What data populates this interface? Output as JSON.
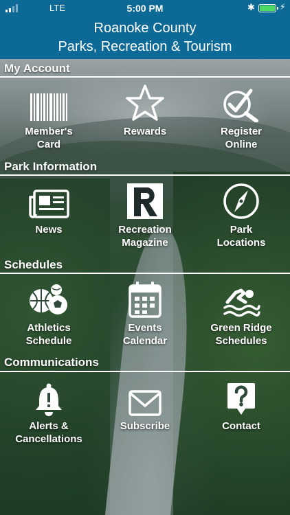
{
  "status_bar": {
    "carrier": "LTE",
    "time": "5:00 PM",
    "battery_level": 1.0
  },
  "header": {
    "title_line1": "Roanoke County",
    "title_line2": "Parks, Recreation & Tourism",
    "background_color": "#0d6a96"
  },
  "sections": [
    {
      "title": "My Account",
      "items": [
        {
          "label_line1": "Member's",
          "label_line2": "Card",
          "icon": "barcode-icon"
        },
        {
          "label_line1": "Rewards",
          "label_line2": "",
          "icon": "star-icon"
        },
        {
          "label_line1": "Register",
          "label_line2": "Online",
          "icon": "checkmark-search-icon"
        }
      ]
    },
    {
      "title": "Park Information",
      "items": [
        {
          "label_line1": "News",
          "label_line2": "",
          "icon": "newspaper-icon"
        },
        {
          "label_line1": "Recreation",
          "label_line2": "Magazine",
          "icon": "r-logo-icon"
        },
        {
          "label_line1": "Park",
          "label_line2": "Locations",
          "icon": "compass-icon"
        }
      ]
    },
    {
      "title": "Schedules",
      "items": [
        {
          "label_line1": "Athletics",
          "label_line2": "Schedule",
          "icon": "sports-balls-icon"
        },
        {
          "label_line1": "Events",
          "label_line2": "Calendar",
          "icon": "calendar-icon"
        },
        {
          "label_line1": "Green Ridge",
          "label_line2": "Schedules",
          "icon": "swimmer-icon"
        }
      ]
    },
    {
      "title": "Communications",
      "items": [
        {
          "label_line1": "Alerts &",
          "label_line2": "Cancellations",
          "icon": "bell-icon"
        },
        {
          "label_line1": "Subscribe",
          "label_line2": "",
          "icon": "envelope-icon"
        },
        {
          "label_line1": "Contact",
          "label_line2": "",
          "icon": "question-bubble-icon"
        }
      ]
    }
  ]
}
